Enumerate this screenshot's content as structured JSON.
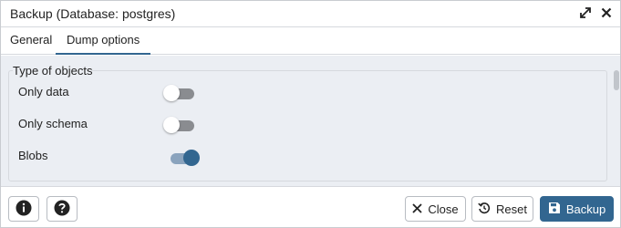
{
  "dialog": {
    "title": "Backup (Database: postgres)",
    "icons": {
      "expand": "expand-icon",
      "close": "close-icon"
    }
  },
  "tabs": [
    {
      "label": "General",
      "active": false
    },
    {
      "label": "Dump options",
      "active": true
    }
  ],
  "section": {
    "legend": "Type of objects",
    "rows": [
      {
        "label": "Only data",
        "on": false
      },
      {
        "label": "Only schema",
        "on": false
      },
      {
        "label": "Blobs",
        "on": true
      }
    ]
  },
  "footer": {
    "info_icon": "info-icon",
    "help_icon": "help-icon",
    "close_label": "Close",
    "reset_label": "Reset",
    "backup_label": "Backup"
  },
  "colors": {
    "accent": "#326690",
    "toggle_off": "#8a8c90",
    "panel_bg": "#ebeef3"
  }
}
